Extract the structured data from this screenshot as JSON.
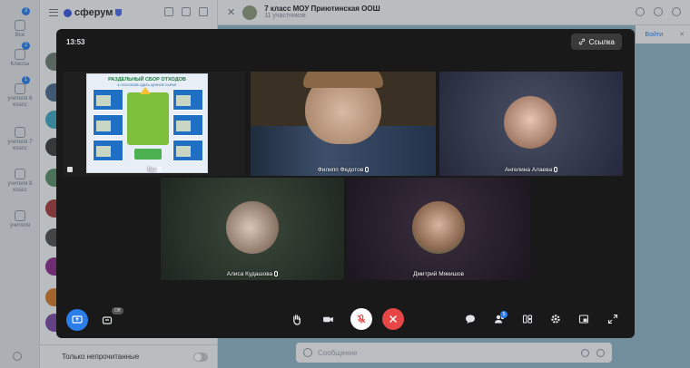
{
  "rail": {
    "top_badge": "3",
    "items": [
      {
        "label": "Все",
        "badge": ""
      },
      {
        "label": "Классы",
        "badge": "2"
      },
      {
        "label": "учителя 6 класс",
        "badge": "1"
      },
      {
        "label": "учителя 7 класс",
        "badge": ""
      },
      {
        "label": "учителя 8 класс",
        "badge": ""
      },
      {
        "label": "учителя",
        "badge": ""
      }
    ]
  },
  "chats": {
    "app_name": "сферум",
    "footer_label": "Только непрочитанные"
  },
  "conversation": {
    "title": "7 класс МОУ Приютинская ООШ",
    "subtitle": "11 участников",
    "pin_action": "Войти",
    "composer_placeholder": "Сообщение"
  },
  "call": {
    "timer": "13:53",
    "link_label": "Ссылка",
    "tiles": [
      {
        "name": "Вы",
        "muted": true
      },
      {
        "name": "Филипп Федотов",
        "muted": true
      },
      {
        "name": "Ангелина Алаева",
        "muted": true
      },
      {
        "name": "Алиса Кудашова",
        "muted": true
      },
      {
        "name": "Дмитрий Мякишов",
        "muted": false
      }
    ],
    "poster": {
      "title": "РАЗДЕЛЬНЫЙ СБОР ОТХОДОВ",
      "subtitle": "6 СПОСОБОВ СДАТЬ ЦЕННОЕ СЫРЬЁ"
    },
    "screen_share_badge": "Off",
    "participants_badge": "5"
  },
  "colors": {
    "call_bg": "#191919",
    "accent": "#2b7de9",
    "end_call": "#e64646"
  }
}
